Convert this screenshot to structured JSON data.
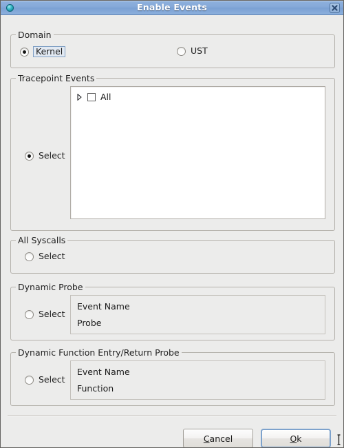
{
  "window": {
    "title": "Enable Events",
    "icon": "app-circle-icon",
    "close_label": "✕"
  },
  "domain": {
    "title": "Domain",
    "options": [
      {
        "label": "Kernel",
        "checked": true,
        "focused": true
      },
      {
        "label": "UST",
        "checked": false,
        "focused": false
      }
    ]
  },
  "tracepoint_events": {
    "title": "Tracepoint Events",
    "select_label": "Select",
    "select_checked": true,
    "tree": {
      "items": [
        {
          "label": "All",
          "expanded": false,
          "checked": false
        }
      ]
    }
  },
  "all_syscalls": {
    "title": "All Syscalls",
    "select_label": "Select",
    "select_checked": false
  },
  "dynamic_probe": {
    "title": "Dynamic Probe",
    "select_label": "Select",
    "select_checked": false,
    "fields": [
      {
        "label": "Event Name"
      },
      {
        "label": "Probe"
      }
    ]
  },
  "dynamic_function_probe": {
    "title": "Dynamic Function Entry/Return Probe",
    "select_label": "Select",
    "select_checked": false,
    "fields": [
      {
        "label": "Event Name"
      },
      {
        "label": "Function"
      }
    ]
  },
  "buttons": {
    "cancel": {
      "mnemonic": "C",
      "rest": "ancel"
    },
    "ok": {
      "mnemonic": "O",
      "rest": "k",
      "is_default": true
    }
  },
  "colors": {
    "titlebar_blue": "#85a9d8",
    "dialog_bg": "#ececeb",
    "group_border": "#b4b1ab",
    "focus_blue": "#7da2cc",
    "text": "#1b1b1b"
  }
}
